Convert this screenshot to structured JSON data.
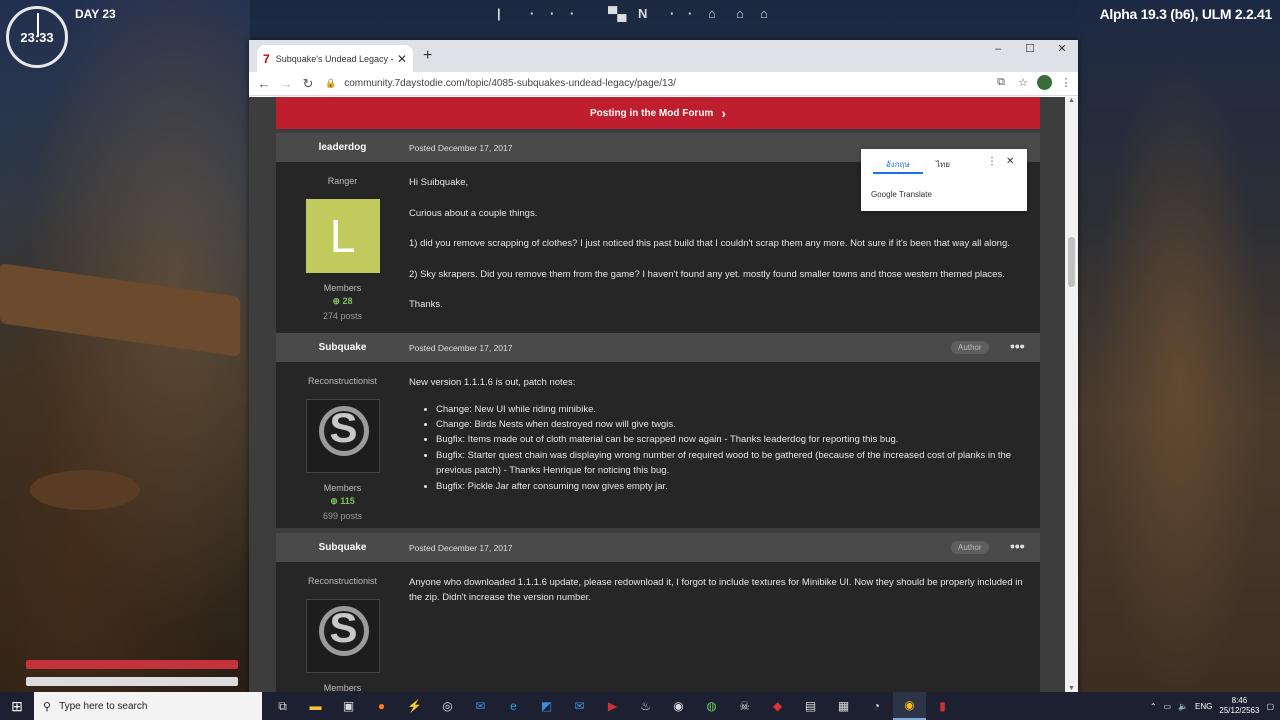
{
  "hud": {
    "clock_time": "23:33",
    "day": "DAY 23",
    "version": "Alpha 19.3 (b6), ULM 2.2.41",
    "compass_letter": "N"
  },
  "browser": {
    "tab_title": "Subquake's Undead Legacy - Pa...",
    "tab_favicon": "7",
    "url": "community.7daystodie.com/topic/4085-subquakes-undead-legacy/page/13/",
    "minimize": "–",
    "maximize": "☐",
    "close": "✕"
  },
  "banner": {
    "label": "Posting in the Mod Forum",
    "chevron": "›"
  },
  "translate_popup": {
    "lang_source": "อังกฤษ",
    "lang_target": "ไทย",
    "brand": "Google Translate"
  },
  "posts": [
    {
      "author": "leaderdog",
      "date": "Posted December 17, 2017",
      "rank": "Ranger",
      "avatar_letter": "L",
      "group": "Members",
      "reputation": "28",
      "post_count": "274 posts",
      "paragraphs": [
        "Hi Suibquake,",
        "Curious about a couple things.",
        "1) did you remove scrapping of clothes? I just noticed this past build that I couldn't scrap them any more. Not sure if it's been that way all along.",
        "2) Sky skrapers. Did you remove them from the game? I haven't found any yet. mostly found smaller towns and those western themed places.",
        "Thanks."
      ]
    },
    {
      "author": "Subquake",
      "date": "Posted December 17, 2017",
      "badge": "Author",
      "rank": "Reconstructionist",
      "avatar_letter": "S",
      "group": "Members",
      "reputation": "115",
      "post_count": "699 posts",
      "intro": "New version 1.1.1.6 is out, patch notes:",
      "items": [
        "Change: New UI while riding minibike.",
        "Change: Birds Nests when destroyed now will give twgis.",
        "Bugfix: Items made out of cloth material can be scrapped now again - Thanks leaderdog for reporting this bug.",
        "Bugfix: Starter quest chain was displaying wrong number of required wood to be gathered (because of the increased cost of planks in the previous patch) - Thanks Henrique for noticing this bug.",
        "Bugfix: Pickle Jar after consuming now gives empty jar."
      ]
    },
    {
      "author": "Subquake",
      "date": "Posted December 17, 2017",
      "badge": "Author",
      "rank": "Reconstructionist",
      "avatar_letter": "S",
      "group": "Members",
      "paragraphs": [
        "Anyone who downloaded 1.1.1.6 update, please redownload it, I forgot to include textures for Minibike UI. Now they should be properly included in the zip. Didn't increase the version number."
      ]
    }
  ],
  "taskbar": {
    "search_placeholder": "Type here to search",
    "lang": "ENG",
    "time": "8:46",
    "date": "25/12/2563"
  },
  "colors": {
    "banner": "#be1e2d",
    "post_bg": "#262626",
    "post_header": "#4a4a4a",
    "reputation": "#7cc25f"
  }
}
